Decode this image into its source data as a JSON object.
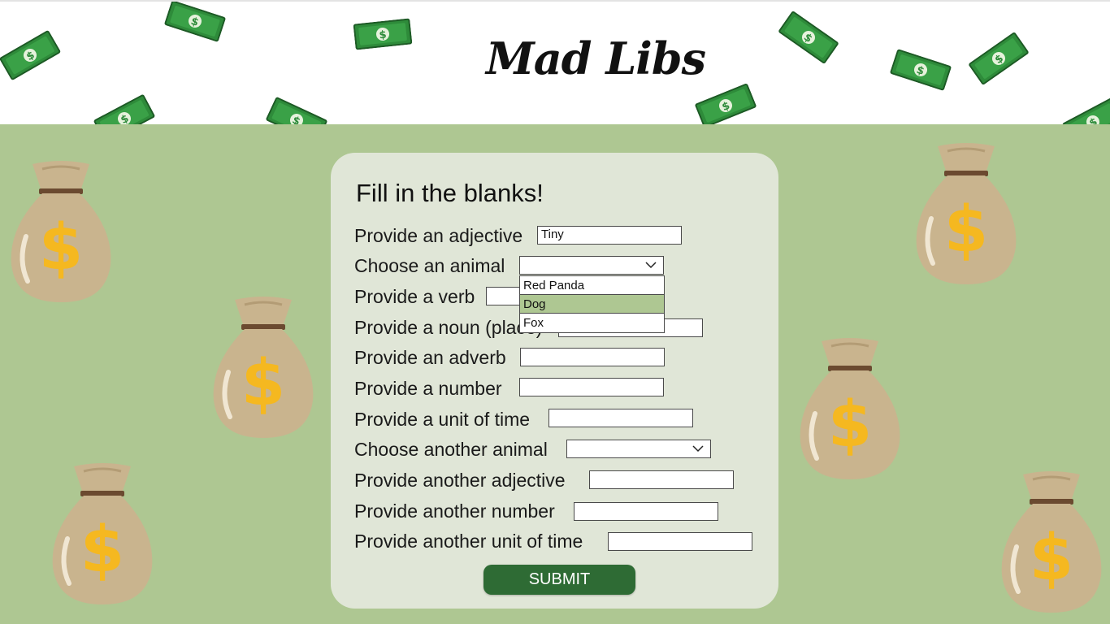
{
  "page": {
    "title": "Mad Libs",
    "colors": {
      "background": "#aec792",
      "card": "#e0e6d7",
      "button": "#2e6b34",
      "highlight": "#aec792"
    }
  },
  "form": {
    "heading": "Fill in the blanks!",
    "fields": {
      "adjective": {
        "label": "Provide an adjective",
        "value": "Tiny"
      },
      "animal": {
        "label": "Choose an animal",
        "value": "",
        "options": [
          "Red Panda",
          "Dog",
          "Fox"
        ],
        "highlighted": "Dog"
      },
      "verb": {
        "label": "Provide a verb",
        "value": ""
      },
      "noun_place": {
        "label": "Provide a noun (place)",
        "value": ""
      },
      "adverb": {
        "label": "Provide an adverb",
        "value": ""
      },
      "number": {
        "label": "Provide a number",
        "value": ""
      },
      "unit_time": {
        "label": "Provide a unit of time",
        "value": ""
      },
      "animal2": {
        "label": "Choose another animal",
        "value": ""
      },
      "adjective2": {
        "label": "Provide another adjective",
        "value": ""
      },
      "number2": {
        "label": "Provide another number",
        "value": ""
      },
      "unit_time2": {
        "label": "Provide another unit of time",
        "value": ""
      }
    },
    "submit_label": "SUBMIT"
  },
  "decor": {
    "icons": [
      "money-bill-icon",
      "money-bag-icon",
      "chevron-down-icon"
    ]
  }
}
